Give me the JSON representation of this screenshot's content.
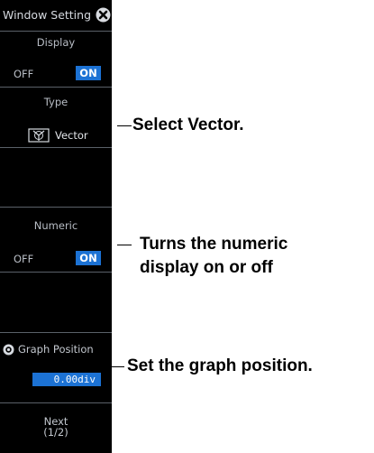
{
  "window": {
    "title": "Window Setting",
    "close_icon": "close-icon"
  },
  "display": {
    "label": "Display",
    "off_label": "OFF",
    "on_label": "ON",
    "state": "ON"
  },
  "type": {
    "label": "Type",
    "value": "Vector",
    "icon": "vector-icon"
  },
  "numeric": {
    "label": "Numeric",
    "off_label": "OFF",
    "on_label": "ON",
    "state": "ON"
  },
  "graph_position": {
    "label": "Graph Position",
    "value": "0.00div",
    "icon": "knob-icon"
  },
  "next": {
    "line1": "Next",
    "line2": "(1/2)"
  },
  "callouts": {
    "type": "Select Vector.",
    "numeric_line1": "Turns the numeric",
    "numeric_line2": "display on or off",
    "graph_position": "Set the graph position."
  },
  "colors": {
    "panel_bg": "#000000",
    "accent": "#1c72d4",
    "text": "#c8ccd4",
    "separator": "#5a6068"
  }
}
